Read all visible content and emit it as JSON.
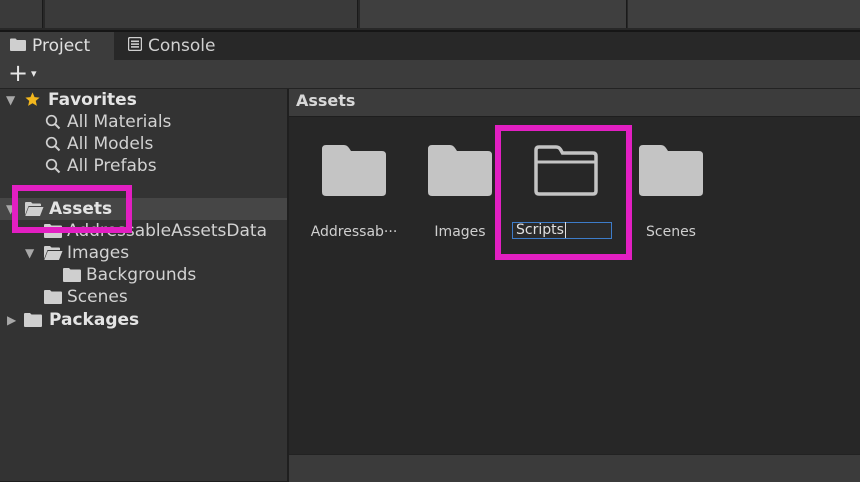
{
  "tabs": [
    {
      "label": "Project",
      "icon": "folder-icon",
      "active": true
    },
    {
      "label": "Console",
      "icon": "console-icon",
      "active": false
    }
  ],
  "toolbar": {
    "add_label": "+",
    "add_caret": "▾"
  },
  "tree": {
    "favorites": {
      "label": "Favorites",
      "icon": "star-icon"
    },
    "favorite_items": [
      {
        "label": "All Materials",
        "icon": "search-icon"
      },
      {
        "label": "All Models",
        "icon": "search-icon"
      },
      {
        "label": "All Prefabs",
        "icon": "search-icon"
      }
    ],
    "assets": {
      "label": "Assets",
      "icon": "folder-open-icon"
    },
    "assets_children": [
      {
        "label": "AddressableAssetsData",
        "icon": "folder-icon"
      },
      {
        "label": "Images",
        "icon": "folder-open-icon"
      },
      {
        "label": "Backgrounds",
        "icon": "folder-icon"
      },
      {
        "label": "Scenes",
        "icon": "folder-icon"
      }
    ],
    "packages": {
      "label": "Packages",
      "icon": "folder-icon"
    }
  },
  "grid": {
    "title": "Assets",
    "items": [
      {
        "label": "Addressab···",
        "icon": "folder-icon"
      },
      {
        "label": "Images",
        "icon": "folder-icon"
      },
      {
        "label": "Scripts",
        "icon": "folder-outline-icon",
        "renaming": true
      },
      {
        "label": "Scenes",
        "icon": "folder-icon"
      }
    ]
  },
  "colors": {
    "highlight": "#e21fc2",
    "star": "#f4b81e",
    "folder": "#c4c4c4",
    "rename_border": "#3d7cc9"
  }
}
